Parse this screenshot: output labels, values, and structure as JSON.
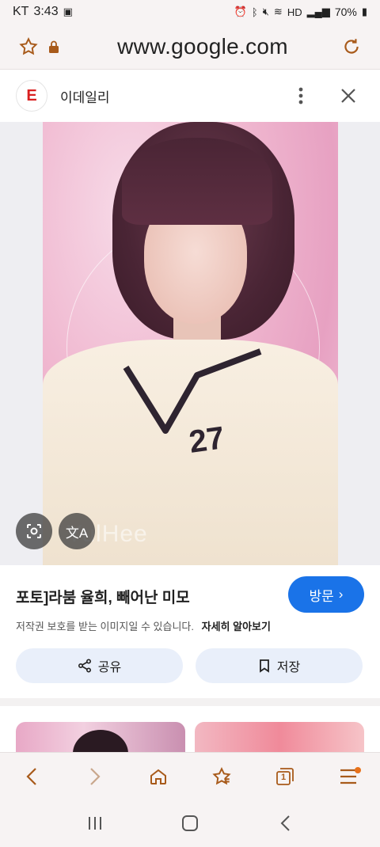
{
  "status_bar": {
    "carrier": "KT",
    "time": "3:43",
    "battery": "70%"
  },
  "browser": {
    "url": "www.google.com"
  },
  "source": {
    "logo_letter": "E",
    "name": "이데일리"
  },
  "image": {
    "jersey_number": "27",
    "watermark": "YulHee"
  },
  "details": {
    "title": "포토]라붐 율희, 빼어난 미모",
    "visit_label": "방문",
    "copyright_notice": "저작권 보호를 받는 이미지일 수 있습니다.",
    "learn_more": "자세히 알아보기",
    "share_label": "공유",
    "save_label": "저장"
  },
  "bottom_nav": {
    "tabs_count": "1"
  },
  "colors": {
    "accent": "#1a73e8",
    "browser_icon": "#a85a1a",
    "notification_dot": "#e8711a"
  }
}
